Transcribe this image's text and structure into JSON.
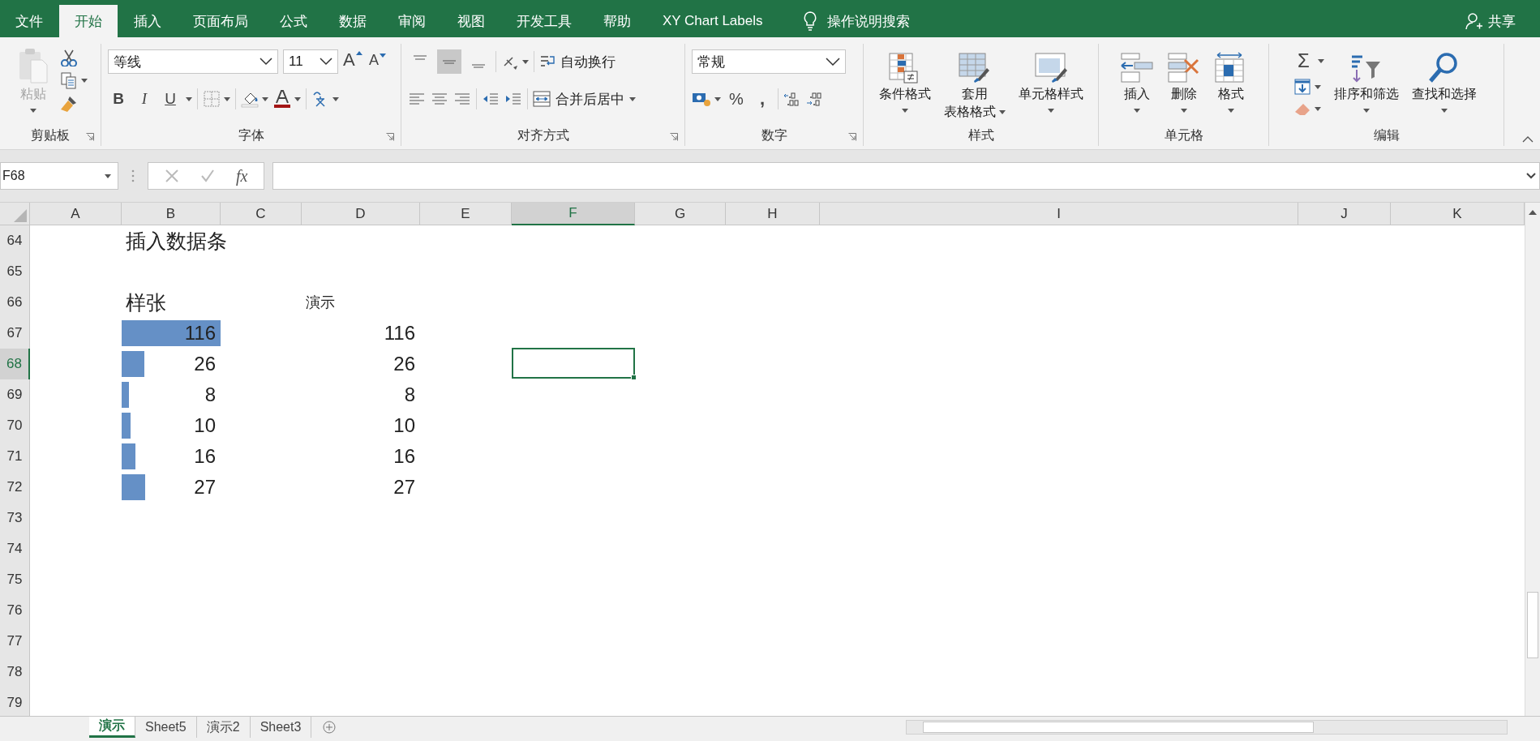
{
  "menu_tabs": [
    {
      "label": "文件",
      "selected": false
    },
    {
      "label": "开始",
      "selected": true
    },
    {
      "label": "插入",
      "selected": false
    },
    {
      "label": "页面布局",
      "selected": false
    },
    {
      "label": "公式",
      "selected": false
    },
    {
      "label": "数据",
      "selected": false
    },
    {
      "label": "审阅",
      "selected": false
    },
    {
      "label": "视图",
      "selected": false
    },
    {
      "label": "开发工具",
      "selected": false
    },
    {
      "label": "帮助",
      "selected": false
    },
    {
      "label": "XY Chart Labels",
      "selected": false
    }
  ],
  "tell_me": "操作说明搜索",
  "share": "共享",
  "ribbon": {
    "clipboard": {
      "label": "剪贴板",
      "paste": "粘贴",
      "paste_disabled": true
    },
    "font": {
      "label": "字体",
      "font_name": "等线",
      "font_size": "11",
      "grow": "A",
      "shrink": "A",
      "bold": "B",
      "italic": "I",
      "underline": "U"
    },
    "alignment": {
      "label": "对齐方式",
      "vertical": [
        {
          "selected": false
        },
        {
          "selected": true
        },
        {
          "selected": false
        }
      ],
      "wrap": "自动换行",
      "merge": "合并后居中"
    },
    "number": {
      "label": "数字",
      "format": "常规",
      "percent": "%",
      "comma": ","
    },
    "styles": {
      "label": "样式",
      "buttons": [
        {
          "lines": [
            "条件格式"
          ]
        },
        {
          "lines": [
            "套用",
            "表格格式"
          ]
        },
        {
          "lines": [
            "单元格样式"
          ]
        }
      ]
    },
    "cells": {
      "label": "单元格",
      "buttons": [
        "插入",
        "删除",
        "格式"
      ]
    },
    "editing": {
      "label": "编辑",
      "sum": "Σ",
      "sort": "排序和筛选",
      "find": "查找和选择"
    }
  },
  "formula_bar": {
    "name_box": "F68",
    "fx": "fx"
  },
  "columns": [
    {
      "label": "A",
      "selected": false
    },
    {
      "label": "B",
      "selected": false
    },
    {
      "label": "C",
      "selected": false
    },
    {
      "label": "D",
      "selected": false
    },
    {
      "label": "E",
      "selected": false
    },
    {
      "label": "F",
      "selected": true
    },
    {
      "label": "G",
      "selected": false
    },
    {
      "label": "H",
      "selected": false
    },
    {
      "label": "I",
      "selected": false
    },
    {
      "label": "J",
      "selected": false
    },
    {
      "label": "K",
      "selected": false
    }
  ],
  "rows": [
    {
      "number": "64",
      "selected": false,
      "cell_b": {
        "kind": "title",
        "text": "插入数据条"
      }
    },
    {
      "number": "65",
      "selected": false
    },
    {
      "number": "66",
      "selected": false,
      "cell_b": {
        "kind": "heading",
        "text": "样张"
      },
      "cell_d": {
        "kind": "label",
        "text": "演示"
      }
    },
    {
      "number": "67",
      "selected": false,
      "cell_b": {
        "kind": "number",
        "text": "116",
        "level": 1
      },
      "cell_d": {
        "kind": "number",
        "text": "116"
      }
    },
    {
      "number": "68",
      "selected": true,
      "cell_b": {
        "kind": "number",
        "text": "26",
        "level": 0.224
      },
      "cell_d": {
        "kind": "number",
        "text": "26"
      }
    },
    {
      "number": "69",
      "selected": false,
      "cell_b": {
        "kind": "number",
        "text": "8",
        "level": 0.069
      },
      "cell_d": {
        "kind": "number",
        "text": "8"
      }
    },
    {
      "number": "70",
      "selected": false,
      "cell_b": {
        "kind": "number",
        "text": "10",
        "level": 0.086
      },
      "cell_d": {
        "kind": "number",
        "text": "10"
      }
    },
    {
      "number": "71",
      "selected": false,
      "cell_b": {
        "kind": "number",
        "text": "16",
        "level": 0.138
      },
      "cell_d": {
        "kind": "number",
        "text": "16"
      }
    },
    {
      "number": "72",
      "selected": false,
      "cell_b": {
        "kind": "number",
        "text": "27",
        "level": 0.233
      },
      "cell_d": {
        "kind": "number",
        "text": "27"
      }
    },
    {
      "number": "73",
      "selected": false
    },
    {
      "number": "74",
      "selected": false
    },
    {
      "number": "75",
      "selected": false
    },
    {
      "number": "76",
      "selected": false
    },
    {
      "number": "77",
      "selected": false
    },
    {
      "number": "78",
      "selected": false
    },
    {
      "number": "79",
      "selected": false
    }
  ],
  "sheet_tabs": [
    {
      "label": "演示",
      "selected": true
    },
    {
      "label": "Sheet5",
      "selected": false
    },
    {
      "label": "演示2",
      "selected": false
    },
    {
      "label": "Sheet3",
      "selected": false
    }
  ]
}
